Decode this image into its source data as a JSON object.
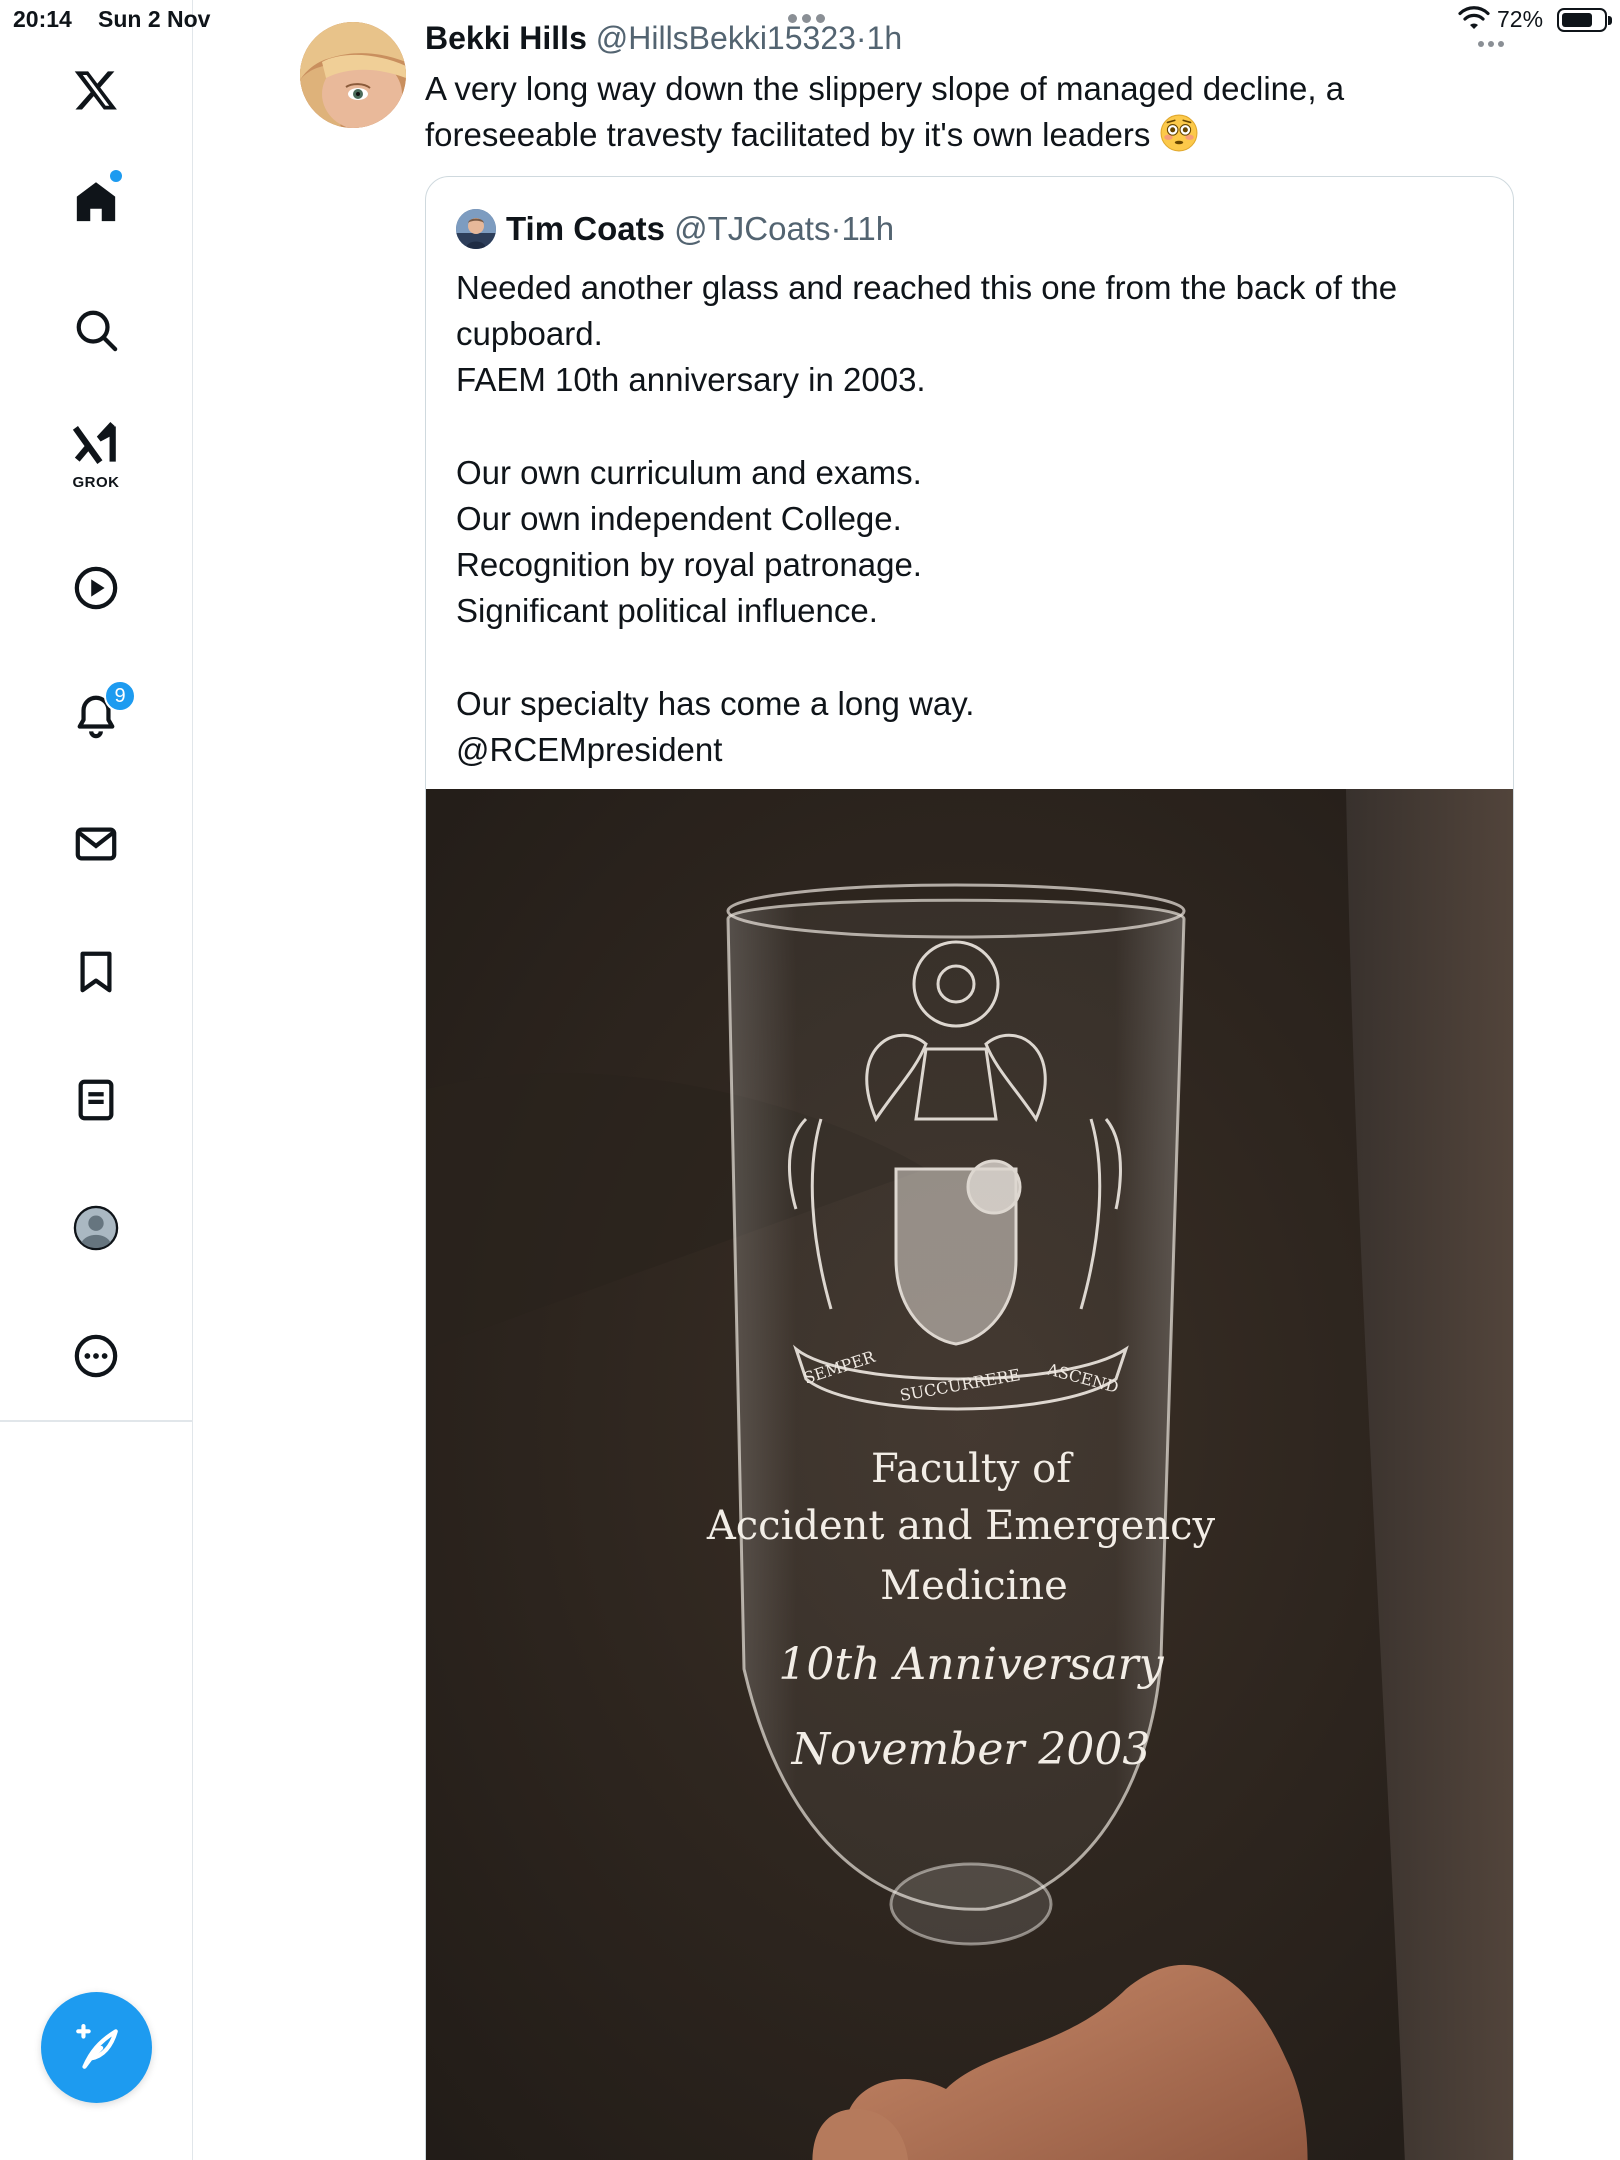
{
  "status_bar": {
    "time": "20:14",
    "date": "Sun 2 Nov",
    "battery_percent": "72%",
    "battery_level": 0.72
  },
  "sidebar": {
    "items": [
      {
        "name": "x-logo",
        "icon": "x-logo-icon"
      },
      {
        "name": "home",
        "icon": "home-icon",
        "has_new": true
      },
      {
        "name": "explore",
        "icon": "search-icon"
      },
      {
        "name": "grok",
        "icon": "grok-icon",
        "label": "GROK"
      },
      {
        "name": "videos",
        "icon": "play-icon"
      },
      {
        "name": "notifications",
        "icon": "bell-icon",
        "badge": "9"
      },
      {
        "name": "messages",
        "icon": "mail-icon"
      },
      {
        "name": "bookmarks",
        "icon": "bookmark-icon"
      },
      {
        "name": "articles",
        "icon": "article-icon"
      },
      {
        "name": "profile",
        "icon": "profile-avatar-icon"
      },
      {
        "name": "more",
        "icon": "more-circle-icon"
      }
    ],
    "compose_icon": "compose-feather-plus-icon",
    "accent_color": "#1d9bf0"
  },
  "tweet": {
    "author_name": "Bekki Hills",
    "author_handle": "@HillsBekki15323",
    "separator": "·",
    "time": "1h",
    "text": "A very long way down the slippery slope of managed decline, a foreseeable travesty facilitated by it's own leaders",
    "emoji": "flushed-face-emoji",
    "quoted": {
      "author_name": "Tim Coats",
      "author_handle": "@TJCoats",
      "separator": "·",
      "time": "11h",
      "text": "Needed another glass and reached this one from the back of the cupboard.\nFAEM 10th anniversary in 2003.\n\nOur own curriculum and exams.\nOur own independent College.\nRecognition by royal patronage.\nSignificant political influence.\n\nOur specialty has come a long way.\n@RCEMpresident",
      "photo": {
        "engraving_line1": "Faculty of",
        "engraving_line2": "Accident and Emergency",
        "engraving_line3": "Medicine",
        "engraving_line4": "10th Anniversary",
        "engraving_line5": "November 2003",
        "motto_left": "SEMPER",
        "motto_center": "SUCCURRERE",
        "motto_right": "ASCEND"
      }
    }
  }
}
